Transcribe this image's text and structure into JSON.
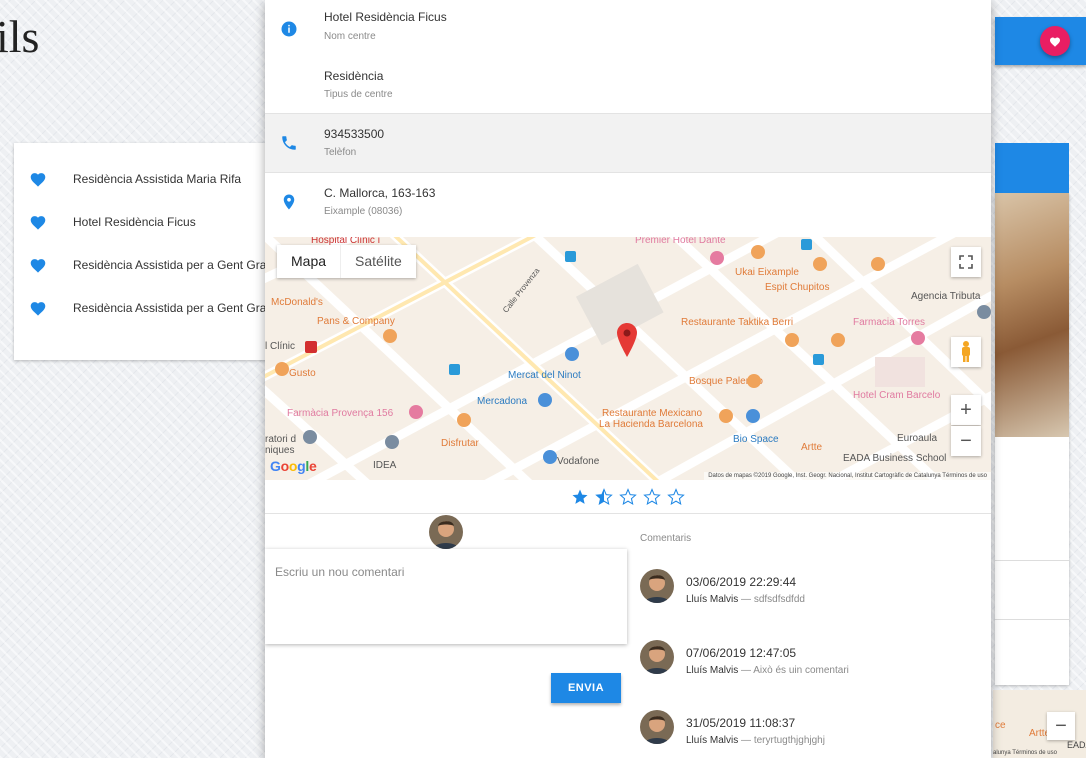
{
  "background": {
    "title_fragment": "ils",
    "favorites": [
      {
        "name": "Residència Assistida Maria Rifa"
      },
      {
        "name": "Hotel Residència Ficus"
      },
      {
        "name": "Residència Assistida per a Gent Gran"
      },
      {
        "name": "Residència Assistida per a Gent Gran"
      }
    ],
    "map_fragment": {
      "label1": "ce",
      "label2": "Artte",
      "label3": "EADA",
      "terms": "alunya   Términos de uso"
    }
  },
  "details": {
    "name": {
      "value": "Hotel Residència Ficus",
      "label": "Nom centre"
    },
    "type": {
      "value": "Residència",
      "label": "Tipus de centre"
    },
    "phone": {
      "value": "934533500",
      "label": "Telèfon"
    },
    "address": {
      "value": "C. Mallorca, 163-163",
      "label": "Eixample (08036)"
    }
  },
  "map": {
    "map_type_options": [
      "Mapa",
      "Satélite"
    ],
    "selected_map_type": "Mapa",
    "zoom_in": "+",
    "zoom_out": "−",
    "logo": "Google",
    "attribution": "Datos de mapas ©2019 Google, Inst. Geogr. Nacional, Institut Cartogràfic de Catalunya   Términos de uso",
    "labels": {
      "hospital": "Hospital Clínic i",
      "premier": "Premier Hotel Dante",
      "ukai": "Ukai Eixample",
      "espit": "Espit Chupitos",
      "agencia": "Agencia Tributa",
      "mcdonalds": "McDonald's",
      "pans": "Pans & Company",
      "taktika": "Restaurante Taktika Berri",
      "farmacia_torres": "Farmacia Torres",
      "clinic": "l Clínic",
      "gusto": "Gusto",
      "mercat": "Mercat del Ninot",
      "bosque": "Bosque Palermo",
      "cram": "Hotel Cram Barcelo",
      "mercadona": "Mercadona",
      "farmacia_provenca": "Farmàcia Provença 156",
      "mexicano1": "Restaurante Mexicano",
      "mexicano2": "La Hacienda Barcelona",
      "bio": "Bio Space",
      "artte": "Artte",
      "euroaula": "Euroaula",
      "eada": "EADA Business School",
      "ratori1": "ratori d",
      "ratori2": "niques",
      "disfrutar": "Disfrutar",
      "idea": "IDEA",
      "vodafone": "Vodafone",
      "calle": "Calle Provenza"
    }
  },
  "rating": {
    "value": 1.5,
    "max": 5
  },
  "composer": {
    "placeholder": "Escriu un nou comentari",
    "send_label": "ENVIA"
  },
  "comments": {
    "title": "Comentaris",
    "items": [
      {
        "date": "03/06/2019 22:29:44",
        "author": "Lluís Malvis",
        "separator": " — ",
        "text": "sdfsdfsdfdd"
      },
      {
        "date": "07/06/2019 12:47:05",
        "author": "Lluís Malvis",
        "separator": " — ",
        "text": "Això és uin comentari"
      },
      {
        "date": "31/05/2019 11:08:37",
        "author": "Lluís Malvis",
        "separator": " — ",
        "text": "teryrtugthjghjghj"
      }
    ]
  },
  "colors": {
    "primary": "#1e88e5",
    "accent": "#e91e63",
    "map_bg": "#f6efe6",
    "pin": "#e53935"
  }
}
